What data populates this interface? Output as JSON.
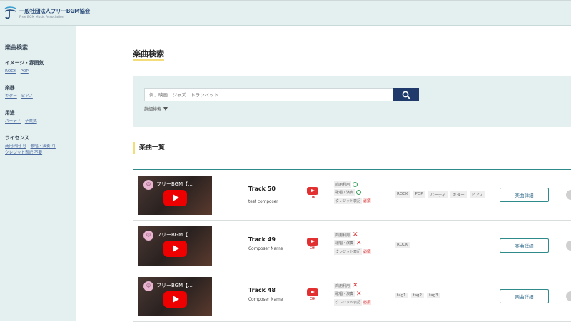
{
  "header": {
    "logo_name": "一般社団法人フリーBGM協会",
    "logo_sub": "Free BGM Music Association"
  },
  "sidebar": {
    "title": "楽曲検索",
    "groups": [
      {
        "head": "イメージ・雰囲気",
        "links": [
          "ROCK",
          "POP"
        ]
      },
      {
        "head": "楽器",
        "links": [
          "ギター",
          "ピアノ"
        ]
      },
      {
        "head": "用途",
        "links": [
          "パーティ",
          "卒業式"
        ]
      },
      {
        "head": "ライセンス",
        "links": [
          "商用利用 可",
          "歌唱・演奏 可",
          "クレジット表記 不要"
        ]
      }
    ]
  },
  "main": {
    "page_title": "楽曲検索",
    "search": {
      "placeholder": "例：映画　ジャズ　トランペット",
      "advanced": "詳細検索"
    },
    "list_title": "楽曲一覧",
    "detail_label": "楽曲詳細",
    "thumb_title": "フリーBGM【...",
    "ok_label": "OK",
    "license_labels": {
      "commercial": "商用利用",
      "perform": "歌唱・演奏",
      "credit": "クレジット表記",
      "required": "必須"
    },
    "tracks": [
      {
        "name": "Track 50",
        "composer": "test composer",
        "commercial": "ok",
        "perform": "ok",
        "tags": [
          "ROCK",
          "POP",
          "パーティ",
          "ギター",
          "ピアノ"
        ]
      },
      {
        "name": "Track 49",
        "composer": "Composer Name",
        "commercial": "ng",
        "perform": "ng",
        "tags": [
          "ROCK"
        ]
      },
      {
        "name": "Track 48",
        "composer": "Composer Name",
        "commercial": "ng",
        "perform": "ng",
        "tags": [
          "tag1",
          "tag2",
          "tag3"
        ]
      }
    ]
  },
  "colors": {
    "panel_bg": "#e4efef",
    "accent_navy": "#1f3a6b",
    "accent_teal": "#2f8a8a",
    "title_underline": "#f3dc7a",
    "youtube_red": "#e00000",
    "ok_green": "#3aa05a",
    "ng_red": "#d03030"
  },
  "icons": {
    "search": "search-icon",
    "youtube": "youtube-play-icon",
    "advanced_toggle": "triangle-down-icon",
    "license_ok": "circle-ok-icon",
    "license_ng": "cross-ng-icon"
  }
}
